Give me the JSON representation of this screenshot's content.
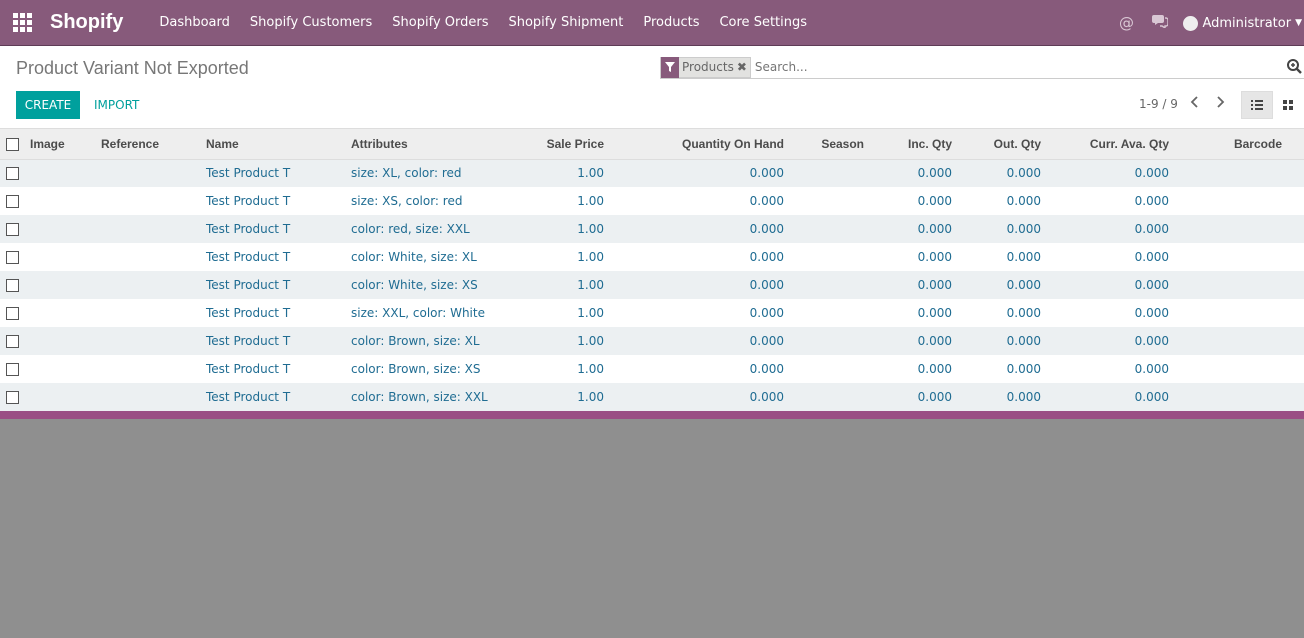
{
  "navbar": {
    "brand": "Shopify",
    "menu": [
      "Dashboard",
      "Shopify Customers",
      "Shopify Orders",
      "Shopify Shipment",
      "Products",
      "Core Settings"
    ],
    "user": "Administrator",
    "icons": [
      "apps-grid-icon",
      "at-sign-icon",
      "chat-icon",
      "avatar",
      "caret-down-icon"
    ]
  },
  "control": {
    "title": "Product Variant Not Exported",
    "facet_label": "Products",
    "search_placeholder": "Search...",
    "create_label": "CREATE",
    "import_label": "IMPORT",
    "pager": "1-9 / 9"
  },
  "table": {
    "columns": [
      "Image",
      "Reference",
      "Name",
      "Attributes",
      "Sale Price",
      "Quantity On Hand",
      "Season",
      "Inc. Qty",
      "Out. Qty",
      "Curr. Ava. Qty",
      "Barcode"
    ],
    "rows": [
      {
        "name": "Test Product T",
        "attributes": "size: XL, color: red",
        "sale_price": "1.00",
        "qoh": "0.000",
        "inc": "0.000",
        "out": "0.000",
        "curr": "0.000"
      },
      {
        "name": "Test Product T",
        "attributes": "size: XS, color: red",
        "sale_price": "1.00",
        "qoh": "0.000",
        "inc": "0.000",
        "out": "0.000",
        "curr": "0.000"
      },
      {
        "name": "Test Product T",
        "attributes": "color: red, size: XXL",
        "sale_price": "1.00",
        "qoh": "0.000",
        "inc": "0.000",
        "out": "0.000",
        "curr": "0.000"
      },
      {
        "name": "Test Product T",
        "attributes": "color: White, size: XL",
        "sale_price": "1.00",
        "qoh": "0.000",
        "inc": "0.000",
        "out": "0.000",
        "curr": "0.000"
      },
      {
        "name": "Test Product T",
        "attributes": "color: White, size: XS",
        "sale_price": "1.00",
        "qoh": "0.000",
        "inc": "0.000",
        "out": "0.000",
        "curr": "0.000"
      },
      {
        "name": "Test Product T",
        "attributes": "size: XXL, color: White",
        "sale_price": "1.00",
        "qoh": "0.000",
        "inc": "0.000",
        "out": "0.000",
        "curr": "0.000"
      },
      {
        "name": "Test Product T",
        "attributes": "color: Brown, size: XL",
        "sale_price": "1.00",
        "qoh": "0.000",
        "inc": "0.000",
        "out": "0.000",
        "curr": "0.000"
      },
      {
        "name": "Test Product T",
        "attributes": "color: Brown, size: XS",
        "sale_price": "1.00",
        "qoh": "0.000",
        "inc": "0.000",
        "out": "0.000",
        "curr": "0.000"
      },
      {
        "name": "Test Product T",
        "attributes": "color: Brown, size: XXL",
        "sale_price": "1.00",
        "qoh": "0.000",
        "inc": "0.000",
        "out": "0.000",
        "curr": "0.000"
      }
    ]
  },
  "colors": {
    "navbar": "#875A7B",
    "primary_button": "#00A09D",
    "link_text": "#1f6c92",
    "backdrop": "#8f8f8f"
  }
}
